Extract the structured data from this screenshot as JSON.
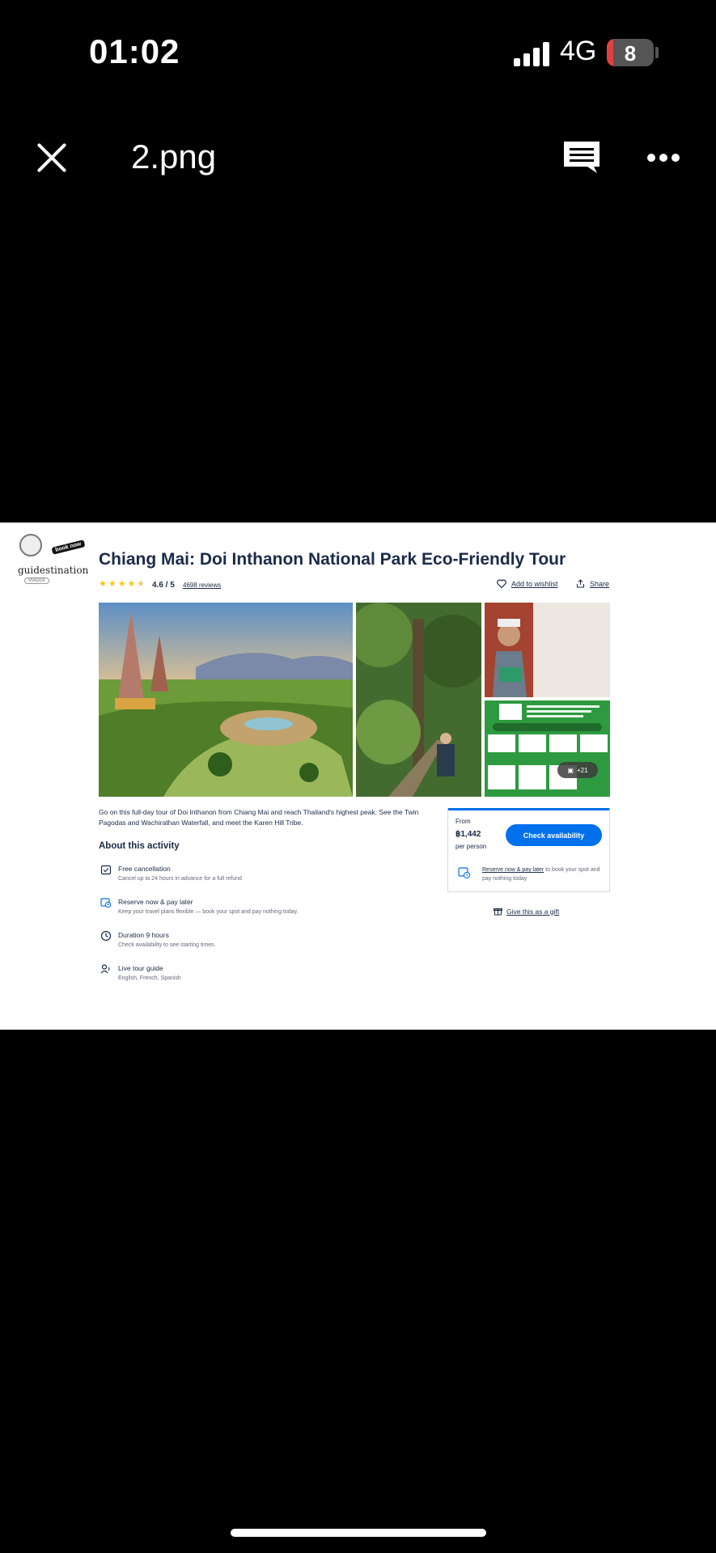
{
  "status_bar": {
    "time": "01:02",
    "network": "4G",
    "battery": "8"
  },
  "viewer": {
    "file_name": "2.png"
  },
  "logo": {
    "tag": "book now",
    "word": "guidestination",
    "sub": "VIAGGI"
  },
  "tour": {
    "title": "Chiang Mai: Doi Inthanon National Park Eco-Friendly Tour",
    "rating": "4.6 / 5",
    "reviews": "4698 reviews",
    "wishlist_label": "Add to wishlist",
    "share_label": "Share",
    "more_photos": "+21",
    "description": "Go on this full-day tour of Doi Inthanon from Chiang Mai and reach Thailand's highest peak. See the Twin Pagodas and Wachirathan Waterfall, and meet the Karen Hill Tribe.",
    "about_heading": "About this activity",
    "features": [
      {
        "title": "Free cancellation",
        "subtitle": "Cancel up to 24 hours in advance for a full refund",
        "icon": "calendar-check-icon"
      },
      {
        "title": "Reserve now & pay later",
        "subtitle": "Keep your travel plans flexible — book your spot and pay nothing today.",
        "icon": "calendar-clock-icon"
      },
      {
        "title": "Duration 9 hours",
        "subtitle": "Check availability to see starting times.",
        "icon": "clock-icon"
      },
      {
        "title": "Live tour guide",
        "subtitle": "English, French, Spanish",
        "icon": "guide-icon"
      }
    ]
  },
  "booking": {
    "from_label": "From",
    "price": "฿1,442",
    "per_person": "per person",
    "check_button": "Check availability",
    "reserve_link": "Reserve now & pay later",
    "reserve_rest": " to book your spot and pay nothing today",
    "gift_label": "Give this as a gift"
  },
  "colors": {
    "accent": "#0071eb",
    "text": "#1a2b49",
    "star": "#fcc419"
  }
}
